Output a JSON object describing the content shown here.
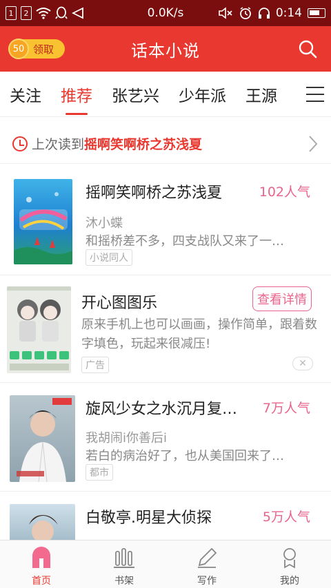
{
  "status_bar": {
    "sim1": "1",
    "sim2": "2",
    "speed": "0.0K/s",
    "time": "0:14"
  },
  "header": {
    "coin_amount": "50",
    "claim_label": "领取",
    "title": "话本小说"
  },
  "tabs": [
    {
      "label": "关注",
      "active": false
    },
    {
      "label": "推荐",
      "active": true
    },
    {
      "label": "张艺兴",
      "active": false
    },
    {
      "label": "少年派",
      "active": false
    },
    {
      "label": "王源",
      "active": false
    }
  ],
  "last_read": {
    "prefix": "上次读到",
    "title": "摇啊笑啊桥之苏浅夏"
  },
  "items": [
    {
      "title": "摇啊笑啊桥之苏浅夏",
      "popularity": "102人气",
      "author": "沐小蝶",
      "desc": "和摇桥差不多，四支战队又来了一…",
      "tag": "小说同人"
    },
    {
      "title": "旋风少女之水沉月复…",
      "popularity": "7万人气",
      "author": "我胡闹i你善后i",
      "desc": "若白的病治好了，也从美国回来了…",
      "tag": "都市"
    },
    {
      "title": "白敬亭.明星大侦探",
      "popularity": "5万人气",
      "author": "",
      "desc": "",
      "tag": ""
    }
  ],
  "ad": {
    "title": "开心图图乐",
    "button": "查看详情",
    "desc": "原来手机上也可以画画，操作简单，跟着数字填色，玩起来很减压!",
    "tag": "广告"
  },
  "bottom_nav": [
    {
      "label": "首页",
      "icon": "home-icon",
      "active": true
    },
    {
      "label": "书架",
      "icon": "bookshelf-icon",
      "active": false
    },
    {
      "label": "写作",
      "icon": "pen-icon",
      "active": false
    },
    {
      "label": "我的",
      "icon": "user-icon",
      "active": false
    }
  ],
  "colors": {
    "brand_red": "#e8382f",
    "popularity_pink": "#e9648c",
    "status_bar": "#7a0d0d"
  }
}
